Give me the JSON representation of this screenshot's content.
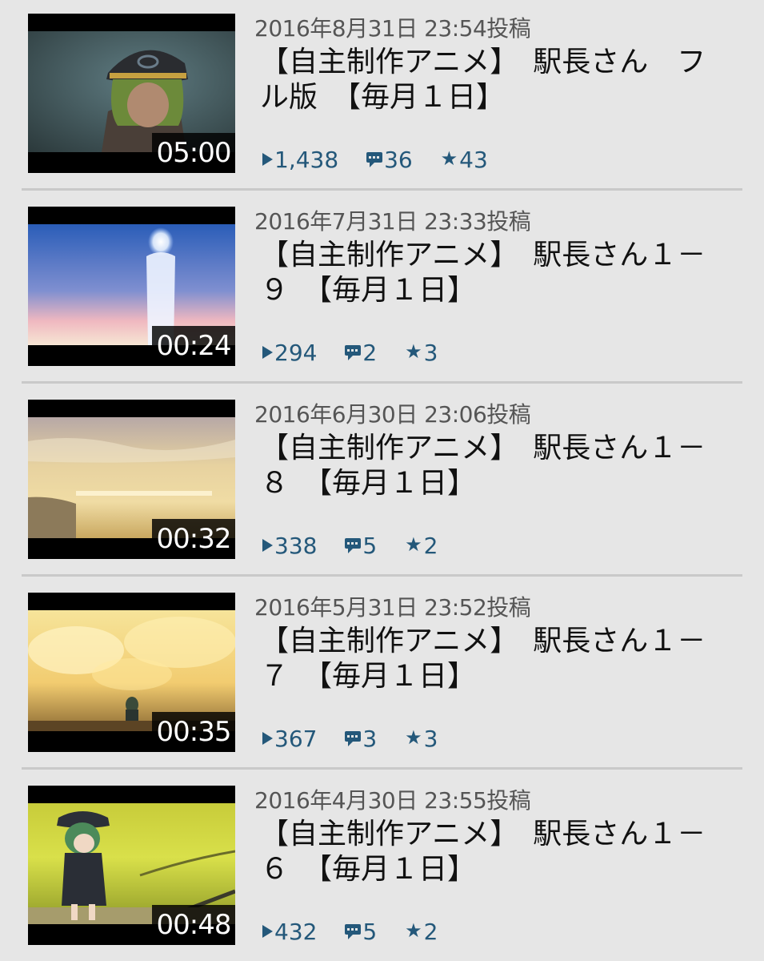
{
  "videos": [
    {
      "date": "2016年8月31日 23:54投稿",
      "title_line1": "【自主制作アニメ】　駅長さん　フ",
      "title_line2": "ル版　【毎月１日】",
      "duration": "05:00",
      "views": "1,438",
      "comments": "36",
      "mylists": "43"
    },
    {
      "date": "2016年7月31日 23:33投稿",
      "title_line1": "【自主制作アニメ】　駅長さん１－",
      "title_line2": "９　【毎月１日】",
      "duration": "00:24",
      "views": "294",
      "comments": "2",
      "mylists": "3"
    },
    {
      "date": "2016年6月30日 23:06投稿",
      "title_line1": "【自主制作アニメ】　駅長さん１－",
      "title_line2": "８　【毎月１日】",
      "duration": "00:32",
      "views": "338",
      "comments": "5",
      "mylists": "2"
    },
    {
      "date": "2016年5月31日 23:52投稿",
      "title_line1": "【自主制作アニメ】　駅長さん１－",
      "title_line2": "７　【毎月１日】",
      "duration": "00:35",
      "views": "367",
      "comments": "3",
      "mylists": "3"
    },
    {
      "date": "2016年4月30日 23:55投稿",
      "title_line1": "【自主制作アニメ】　駅長さん１－",
      "title_line2": "６　【毎月１日】",
      "duration": "00:48",
      "views": "432",
      "comments": "5",
      "mylists": "2"
    }
  ],
  "icons": {
    "views": "play-icon",
    "comments": "comment-icon",
    "mylists": "star-icon"
  },
  "colors": {
    "background": "#e6e6e6",
    "stats": "#24587a",
    "divider": "#c9c9c9"
  }
}
